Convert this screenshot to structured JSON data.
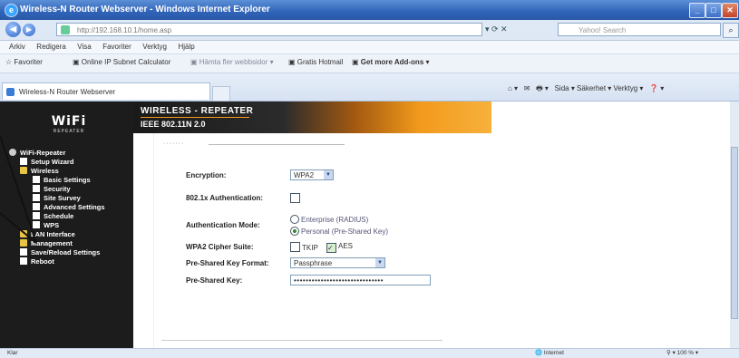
{
  "window": {
    "title": "Wireless-N Router Webserver - Windows Internet Explorer"
  },
  "addressbar": {
    "url": "http://192.168.10.1/home.asp",
    "search_placeholder": "Yahoo! Search"
  },
  "menubar": {
    "items": [
      "Arkiv",
      "Redigera",
      "Visa",
      "Favoriter",
      "Verktyg",
      "Hjälp"
    ]
  },
  "favbar": {
    "favorites_label": "Favoriter",
    "item1": "Online IP Subnet Calculator",
    "item2": "Hämta fler webbsidor",
    "item3": "Gratis Hotmail",
    "item4": "Get more Add-ons"
  },
  "tabs": {
    "active": "Wireless-N Router Webserver",
    "cmd": "Sida ▾   Säkerhet ▾   Verktyg ▾"
  },
  "logo": {
    "text": "WiFi",
    "sub": "REPEATER"
  },
  "banner": {
    "line1": "WIRELESS - REPEATER",
    "line2": "IEEE 802.11N 2.0"
  },
  "sidebar": {
    "items": [
      {
        "label": "WiFi-Repeater"
      },
      {
        "label": "Setup Wizard"
      },
      {
        "label": "Wireless"
      },
      {
        "label": "Basic Settings"
      },
      {
        "label": "Security"
      },
      {
        "label": "Site Survey"
      },
      {
        "label": "Advanced Settings"
      },
      {
        "label": "Schedule"
      },
      {
        "label": "WPS"
      },
      {
        "label": "LAN Interface"
      },
      {
        "label": "Management"
      },
      {
        "label": "Save/Reload Settings"
      },
      {
        "label": "Reboot"
      }
    ]
  },
  "form": {
    "encryption_label": "Encryption:",
    "encryption_value": "WPA2",
    "auth8021x_label": "802.1x Authentication:",
    "auth_mode_label": "Authentication Mode:",
    "auth_enterprise": "Enterprise (RADIUS)",
    "auth_personal": "Personal (Pre-Shared Key)",
    "cipher_label": "WPA2 Cipher Suite:",
    "cipher_tkip": "TKIP",
    "cipher_aes": "AES",
    "psk_format_label": "Pre-Shared Key Format:",
    "psk_format_value": "Passphrase",
    "psk_label": "Pre-Shared Key:",
    "psk_value": "••••••••••••••••••••••••••••••"
  },
  "statusbar": {
    "left": "Klar",
    "zone": "Internet",
    "zoom": "100 %"
  }
}
